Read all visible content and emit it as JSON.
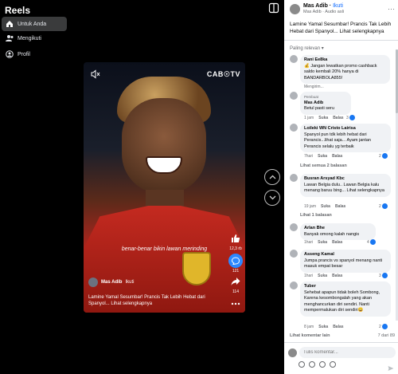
{
  "sidebar": {
    "title": "Reels",
    "items": [
      {
        "label": "Untuk Anda",
        "icon": "home-icon",
        "active": true
      },
      {
        "label": "Mengikuti",
        "icon": "people-icon",
        "active": false
      },
      {
        "label": "Profil",
        "icon": "profile-icon",
        "active": false
      }
    ]
  },
  "video": {
    "logo": "CAB☉TV",
    "subtitle": "benar-benar bikin lawan merinding",
    "author": "Mas Adib",
    "follow": "Ikuti",
    "caption": "Lamine Yamal Sesumbar! Prancis Tak Lebih Hebat dari Spanyol... Lihat selengkapnya"
  },
  "rail": {
    "likes": "12,3 rb",
    "comments": "121",
    "shares": "114"
  },
  "panel": {
    "author": "Mas Adib",
    "follow": "Ikuti",
    "sub": "Mas Adib · Audio asli",
    "caption": "Lamine Yamal Sesumbar! Prancis Tak Lebih Hebat dari Spanyol... Lihat selengkapnya",
    "sort": "Paling relevan",
    "comments": [
      {
        "name": "Rani Ee8ka",
        "text": "💰 Jangan lewatkan promo cashback saldo kembali 20% hanya di BANDARBOLA855!",
        "meta": "Mengirim..."
      },
      {
        "name": "Mas Adib",
        "badge": "Pembuat",
        "text": "Betul pasti seru",
        "time": "1 jam",
        "like": "Suka",
        "reply": "Balas",
        "count": "3"
      },
      {
        "name": "Loileki WN Cristo Lairisa",
        "text": "Spanyol pun tdk lebih hebat dari Perancis...lihat saja... Ayam jantan Perancis selalu yg terbaik",
        "time": "7hari",
        "like": "Suka",
        "reply": "Balas",
        "count": "2"
      },
      {
        "name": "Busran Arsyad Kbc",
        "text": "Lawan Belgia dulu.. Lawan Belgia kalu menang baruu bing... Lihat selengkapnya",
        "time": "19 jam",
        "like": "Suka",
        "reply": "Balas",
        "count": "2"
      },
      {
        "name": "Arlan Bhe",
        "text": "Banyak omong kalah nangis",
        "time": "1hari",
        "like": "Suka",
        "reply": "Balas",
        "count": "4"
      },
      {
        "name": "Asseng Kamal",
        "text": "Jumpa prancis vs spanyol menang nanti masuk empat besar",
        "time": "1hari",
        "like": "Suka",
        "reply": "Balas",
        "count": "3"
      },
      {
        "name": "Tuber",
        "text": "Sehebat apapun tidak boleh Sombong, Karena kesombongalah yang akan menghancurkan diri sendiri. Nanti mempermalukan diri sendiri😀",
        "time": "8 jam",
        "like": "Suka",
        "reply": "Balas",
        "count": "2"
      }
    ],
    "view_replies_1": "Lihat semua 2 balasan",
    "view_replies_2": "Lihat 1 balasan",
    "more_comments": "Lihat komentar lain",
    "page_count": "7 dari 89",
    "input_placeholder": "Tulis komentar..."
  }
}
